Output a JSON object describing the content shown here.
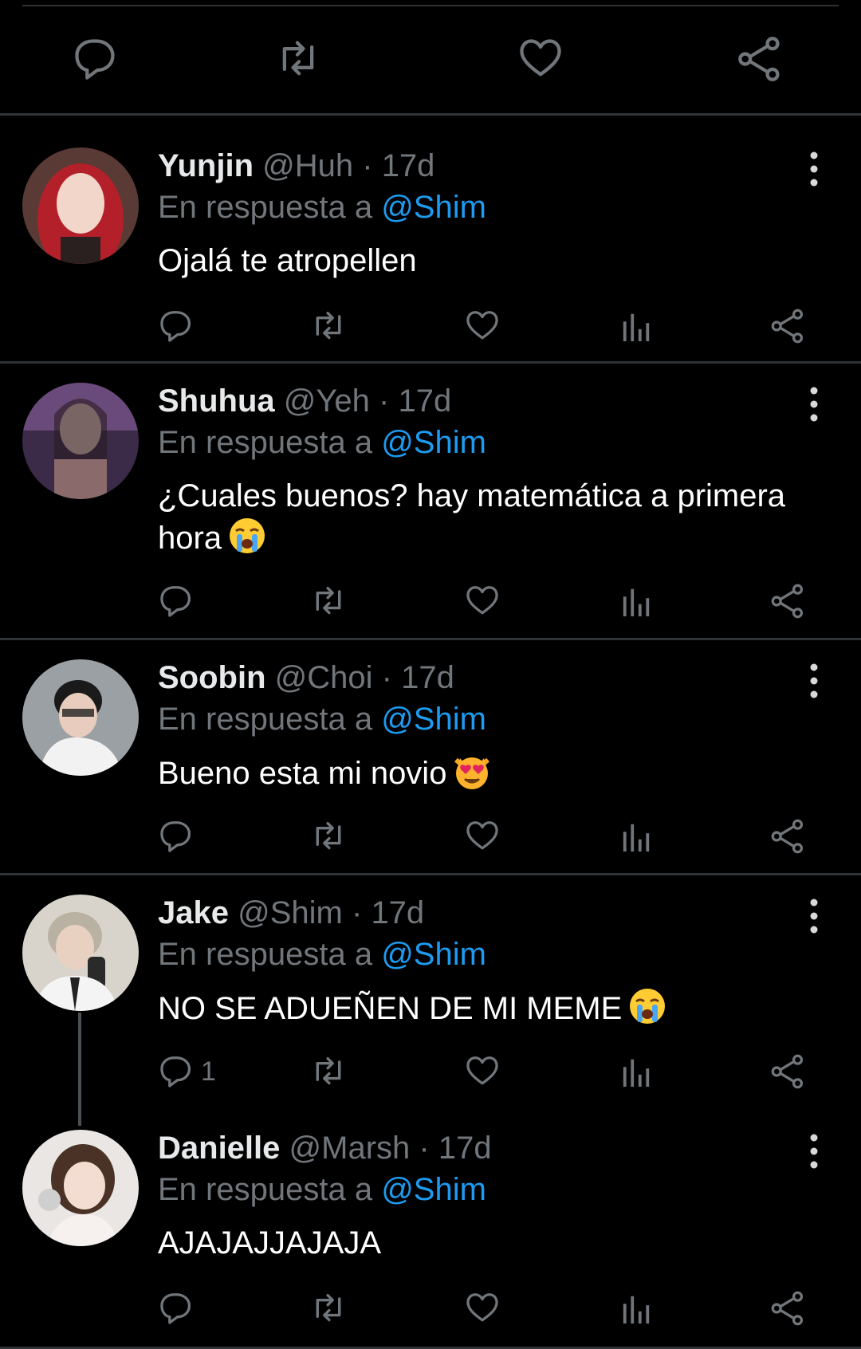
{
  "colors": {
    "background": "#000000",
    "accent": "#1d9bf0",
    "muted": "#71767b",
    "divider": "#2f3336"
  },
  "main_actions": [
    "reply-icon",
    "retweet-icon",
    "like-icon",
    "share-icon"
  ],
  "tweets": [
    {
      "name": "Yunjin",
      "handle": "@Huh",
      "dot": "·",
      "time": "17d",
      "reply_prefix": "En respuesta a",
      "reply_to": "@Shim",
      "text": "Ojalá te atropellen",
      "emoji": "",
      "reply_count": ""
    },
    {
      "name": "Shuhua",
      "handle": "@Yeh",
      "dot": "·",
      "time": "17d",
      "reply_prefix": "En respuesta a",
      "reply_to": "@Shim",
      "text": "¿Cuales buenos? hay matemática a primera hora",
      "emoji": "loudly-crying-face",
      "reply_count": ""
    },
    {
      "name": "Soobin",
      "handle": "@Choi",
      "dot": "·",
      "time": "17d",
      "reply_prefix": "En respuesta a",
      "reply_to": "@Shim",
      "text": "Bueno esta mi novio",
      "emoji": "heart-eyes-cat",
      "reply_count": ""
    },
    {
      "name": "Jake",
      "handle": "@Shim",
      "dot": "·",
      "time": "17d",
      "reply_prefix": "En respuesta a",
      "reply_to": "@Shim",
      "text": "NO SE ADUEÑEN DE MI MEME",
      "emoji": "loudly-crying-face",
      "reply_count": "1"
    },
    {
      "name": "Danielle",
      "handle": "@Marsh",
      "dot": "·",
      "time": "17d",
      "reply_prefix": "En respuesta a",
      "reply_to": "@Shim",
      "text": "AJAJAJJAJAJA",
      "emoji": "",
      "reply_count": ""
    }
  ]
}
